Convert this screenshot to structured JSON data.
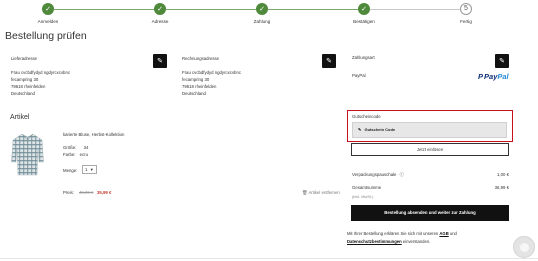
{
  "steps": [
    {
      "label": "Anmelden",
      "state": "done"
    },
    {
      "label": "Adresse",
      "state": "done"
    },
    {
      "label": "Zahlung",
      "state": "done"
    },
    {
      "label": "Bestätigen",
      "state": "done"
    },
    {
      "label": "Fertig",
      "number": "5",
      "state": "todo"
    }
  ],
  "step_done_symbol": "✓",
  "page_title": "Bestellung prüfen",
  "shipping": {
    "heading": "Lieferadresse",
    "lines": [
      "Frau cvcbdfydyd ngdyrcxcvbnc",
      "fecampring 30",
      "79618 rheinfelden",
      "Deutschland"
    ]
  },
  "billing": {
    "heading": "Rechnungsadresse",
    "lines": [
      "Frau cvcbdfydyd ngdyrcxcvbnc",
      "fecampring 30",
      "79618 rheinfelden",
      "Deutschland"
    ]
  },
  "payment": {
    "heading": "Zahlungsart",
    "method": "PayPal",
    "logo_part1": "Pay",
    "logo_part2": "Pal",
    "logo_mark": "P"
  },
  "edit_icon_glyph": "✎",
  "articles": {
    "heading": "Artikel",
    "item": {
      "name": "karierte Bluse, Herbst-Kollektion",
      "size_label": "Größe:",
      "size_value": "34",
      "color_label": "Farbe:",
      "color_value": "ecru",
      "qty_label": "Menge:",
      "qty_value": "1",
      "qty_caret": "▾",
      "price_label": "Preis:",
      "price_old": "49,99 €",
      "price_new": "35,99 €",
      "remove_icon": "🗑",
      "remove_label": "Artikel entfernen"
    }
  },
  "coupon": {
    "heading": "Gutscheincode",
    "input_icon": "✎",
    "input_label": "Gutschein Code",
    "redeem_label": "Jetzt einlösen"
  },
  "summary": {
    "shipping_label": "Verpackungspauschale",
    "shipping_info": "ⓘ",
    "shipping_value": "1,00 €",
    "total_label": "Gesamtsumme",
    "total_value": "36,99 €",
    "vat_note": "(inkl. MwSt.)"
  },
  "order_button": "Bestellung absenden und weiter zur Zahlung",
  "legal": {
    "prefix": "Mit Ihrer Bestellung erklären Sie sich mit unseren",
    "agb": "AGB",
    "und": "und",
    "privacy": "Datenschutzbestimmungen",
    "suffix": "einverstanden."
  },
  "colors": {
    "accent_green": "#4f8a3c",
    "coupon_highlight": "#c8101c",
    "sale_red": "#c0392b",
    "paypal_dark": "#0c2f74",
    "paypal_light": "#2a8bd8"
  }
}
